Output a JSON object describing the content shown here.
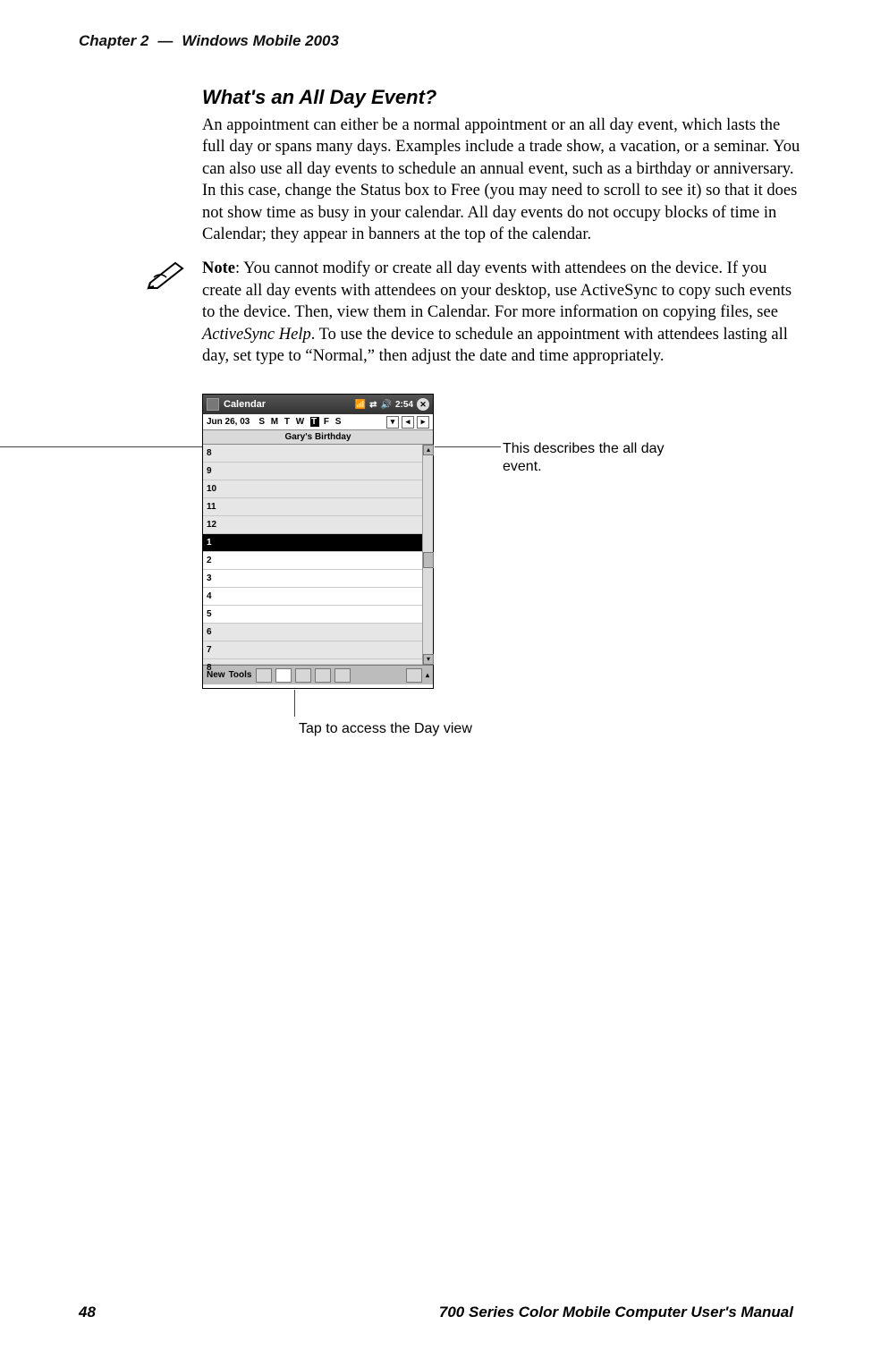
{
  "header": {
    "chapter": "Chapter 2",
    "dash": "—",
    "title": "Windows Mobile 2003"
  },
  "section": {
    "title": "What's an All Day Event?",
    "para": "An appointment can either be a normal appointment or an all day event, which lasts the full day or spans many days. Examples include a trade show, a vacation, or a seminar. You can also use all day events to schedule an annual event, such as a birthday or anniversary. In this case, change the Status box to Free (you may need to scroll to see it) so that it does not show time as busy in your calendar. All day events do not occupy blocks of time in Calendar; they appear in banners at the top of the calendar."
  },
  "note": {
    "label": "Note",
    "text": ": You cannot modify or create all day events with attendees on the device. If you create all day events with attendees on your desktop, use ActiveSync to copy such events to the device. Then, view them in Calendar. For more information on copying files, see ",
    "emph": "ActiveSync Help",
    "text2": ". To use the device to schedule an appointment with attendees lasting all day, set type to “Normal,” then adjust the date and time appropriately."
  },
  "screenshot": {
    "app_title": "Calendar",
    "time": "2:54",
    "date": "Jun 26, 03",
    "days_pre": "S M T W ",
    "day_sel": "T",
    "days_post": " F S",
    "banner": "Gary's Birthday",
    "hours": [
      "8",
      "9",
      "10",
      "11",
      "12",
      "1",
      "2",
      "3",
      "4",
      "5",
      "6",
      "7",
      "8"
    ],
    "selected_hour_index": 5,
    "bottom_new": "New",
    "bottom_tools": "Tools"
  },
  "callouts": {
    "right": "This describes the all day event.",
    "bottom": "Tap to access the Day view"
  },
  "footer": {
    "page": "48",
    "manual": "700 Series Color Mobile Computer User's Manual"
  }
}
